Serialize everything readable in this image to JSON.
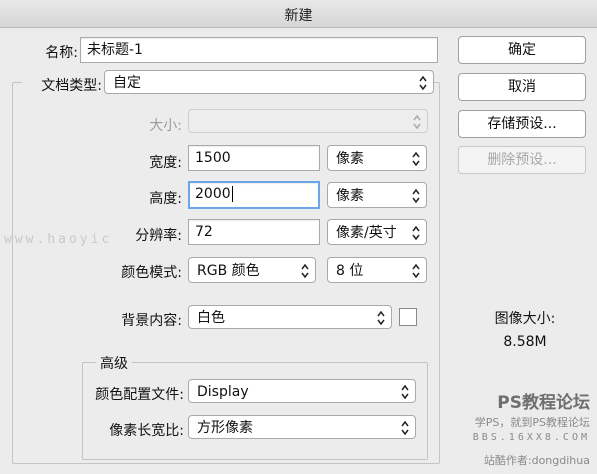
{
  "dialog": {
    "title": "新建"
  },
  "form": {
    "name_label": "名称:",
    "name_value": "未标题-1",
    "doc_type_label": "文档类型:",
    "doc_type_value": "自定",
    "size_label": "大小:",
    "size_value": "",
    "width_label": "宽度:",
    "width_value": "1500",
    "width_unit": "像素",
    "height_label": "高度:",
    "height_value": "2000",
    "height_unit": "像素",
    "resolution_label": "分辨率:",
    "resolution_value": "72",
    "resolution_unit": "像素/英寸",
    "color_mode_label": "颜色模式:",
    "color_mode_value": "RGB 颜色",
    "bit_depth_value": "8 位",
    "background_label": "背景内容:",
    "background_value": "白色",
    "background_swatch_color": "#ffffff"
  },
  "advanced": {
    "title": "高级",
    "color_profile_label": "颜色配置文件:",
    "color_profile_value": "Display",
    "pixel_aspect_label": "像素长宽比:",
    "pixel_aspect_value": "方形像素"
  },
  "buttons": {
    "ok": "确定",
    "cancel": "取消",
    "save_preset": "存储预设...",
    "delete_preset": "删除预设..."
  },
  "image_size": {
    "label": "图像大小:",
    "value": "8.58M"
  },
  "watermarks": {
    "url": "www.haoyic",
    "forum_title": "PS教程论坛",
    "forum_slogan": "学PS，就到PS教程论坛",
    "forum_url": "BBS.16XX8.COM",
    "author": "站酷作者:dongdihua"
  }
}
